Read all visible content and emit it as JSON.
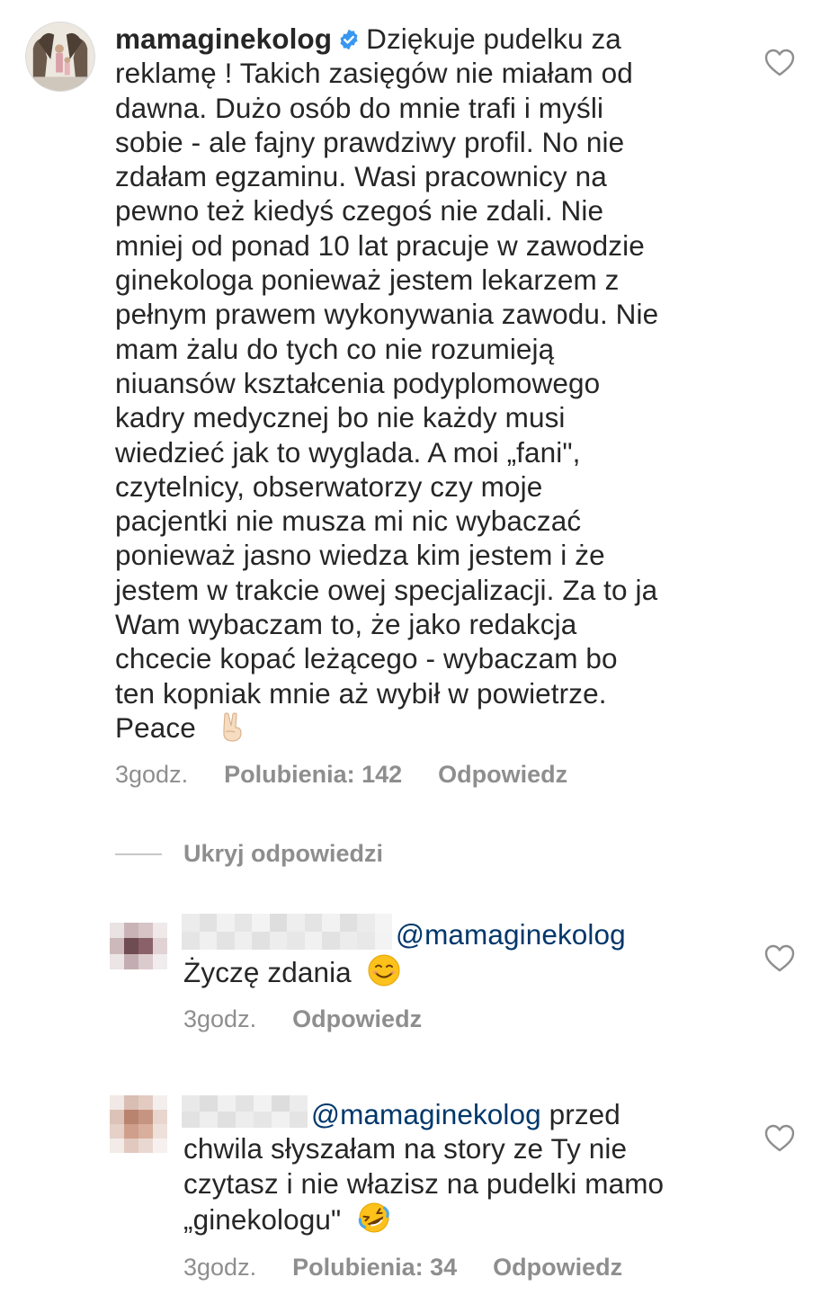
{
  "main_comment": {
    "username": "mamaginekolog",
    "verified_icon": "verified-badge-icon",
    "text": "Dziękuje pudelku za reklamę ! Takich zasięgów nie miałam od dawna. Dużo osób do mnie trafi i myśli sobie - ale fajny prawdziwy profil. No nie zdałam egzaminu. Wasi pracownicy na pewno też kiedyś czegoś nie zdali. Nie mniej od ponad 10 lat pracuje w zawodzie ginekologa ponieważ jestem lekarzem z pełnym prawem wykonywania zawodu. Nie mam żalu do tych co nie rozumieją niuansów kształcenia podyplomowego kadry medycznej bo nie każdy musi wiedzieć jak to wyglada. A moi „fani\", czytelnicy, obserwatorzy czy moje pacjentki nie musza mi nic wybaczać ponieważ jasno wiedza kim jestem i że jestem w trakcie owej specjalizacji. Za to ja Wam wybaczam to, że jako redakcja chcecie kopać leżącego - wybaczam bo ten kopniak mnie aż wybił w powietrze.",
    "text_lines": [
      "Dziękuje pudelku za",
      "reklamę ! Takich zasięgów nie miałam od",
      "dawna. Dużo osób do mnie trafi i myśli",
      "sobie - ale fajny prawdziwy profil. No nie",
      "zdałam egzaminu. Wasi pracownicy na",
      "pewno też kiedyś czegoś nie zdali. Nie",
      "mniej od ponad 10 lat pracuje w zawodzie",
      "ginekologa ponieważ jestem lekarzem z",
      "pełnym prawem wykonywania zawodu. Nie",
      "mam żalu do tych co nie rozumieją",
      "niuansów kształcenia podyplomowego",
      "kadry medycznej bo nie każdy musi",
      "wiedzieć jak to wyglada. A moi „fani\",",
      "czytelnicy, obserwatorzy czy moje",
      "pacjentki nie musza mi nic wybaczać",
      "ponieważ jasno wiedza kim jestem i że",
      "jestem w trakcie owej specjalizacji. Za to ja",
      "Wam wybaczam to, że jako redakcja",
      "chcecie kopać leżącego - wybaczam bo",
      "ten kopniak mnie aż wybił w powietrze."
    ],
    "last_line": "Peace",
    "emoji": "victory-hand-emoji",
    "time": "3godz.",
    "likes": "Polubienia: 142",
    "reply": "Odpowiedz"
  },
  "hide_replies_label": "Ukryj odpowiedzi",
  "replies": [
    {
      "mention": "@mamaginekolog",
      "text": "Życzę zdania",
      "emoji": "smiling-face-emoji",
      "time": "3godz.",
      "reply": "Odpowiedz"
    },
    {
      "mention": "@mamaginekolog",
      "text_first": "przed",
      "text_lines": [
        "chwila słyszałam na story ze Ty nie",
        "czytasz i nie włazisz na pudelki mamo",
        "„ginekologu\""
      ],
      "emoji": "rolling-on-floor-laughing-emoji",
      "time": "3godz.",
      "likes": "Polubienia: 34",
      "reply": "Odpowiedz"
    }
  ],
  "colors": {
    "text": "#262626",
    "meta": "#8e8e8e",
    "mention": "#00376b",
    "verified": "#3897f0"
  }
}
